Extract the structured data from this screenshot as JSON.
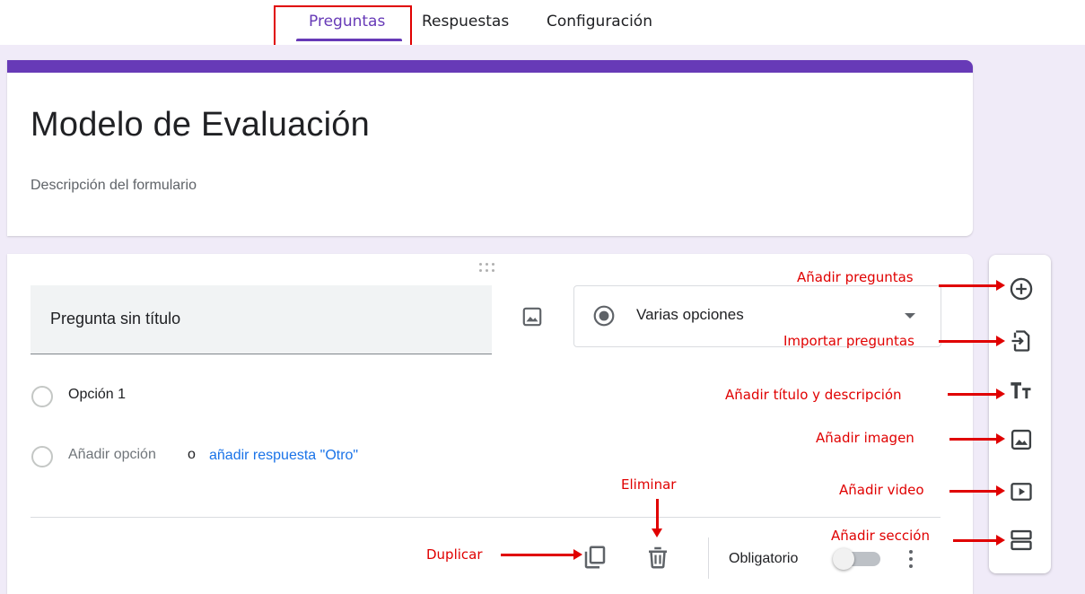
{
  "tabs": {
    "questions": "Preguntas",
    "responses": "Respuestas",
    "settings": "Configuración"
  },
  "form": {
    "title": "Modelo de Evaluación",
    "description_placeholder": "Descripción del formulario"
  },
  "question": {
    "title": "Pregunta sin título",
    "type": "Varias opciones",
    "option1": "Opción 1",
    "add_option": "Añadir opción",
    "or": "o",
    "add_other": "añadir respuesta \"Otro\"",
    "required_label": "Obligatorio",
    "required": false
  },
  "side_toolbar": {
    "items": [
      "add-question-icon",
      "import-questions-icon",
      "title-description-icon",
      "image-icon",
      "video-icon",
      "section-icon"
    ]
  },
  "annotations": {
    "add_questions": "Añadir preguntas",
    "import_questions": "Importar preguntas",
    "add_title_desc": "Añadir título y descripción",
    "add_image": "Añadir imagen",
    "add_video": "Añadir video",
    "add_section": "Añadir sección",
    "delete": "Eliminar",
    "duplicate": "Duplicar"
  },
  "colors": {
    "accent": "#673ab7",
    "background": "#f0ebf8",
    "annotation": "#e00000",
    "link": "#1a73e8"
  }
}
